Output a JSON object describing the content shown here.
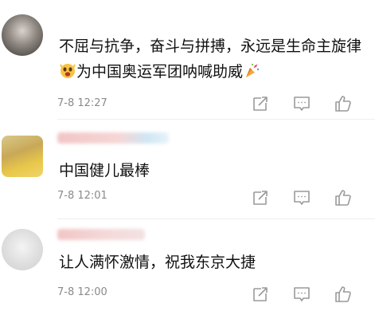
{
  "comments": [
    {
      "text_part1": "不屈与抗争，奋斗与拼搏，永远是生命主旋律",
      "text_part2": "为中国奥运军团呐喊助威",
      "time": "7-8 12:27",
      "emojis": [
        "cheering-face-emoji",
        "party-popper-emoji"
      ]
    },
    {
      "text": "中国健儿最棒",
      "time": "7-8 12:01"
    },
    {
      "text": "让人满怀激情，祝我东京大捷",
      "time": "7-8 12:00"
    }
  ],
  "icons": [
    "share-icon",
    "comment-icon",
    "like-icon"
  ],
  "colors": {
    "text": "#111111",
    "meta": "#8a8a8a",
    "icon": "#9a9a9a",
    "divider": "#eeeeee"
  }
}
